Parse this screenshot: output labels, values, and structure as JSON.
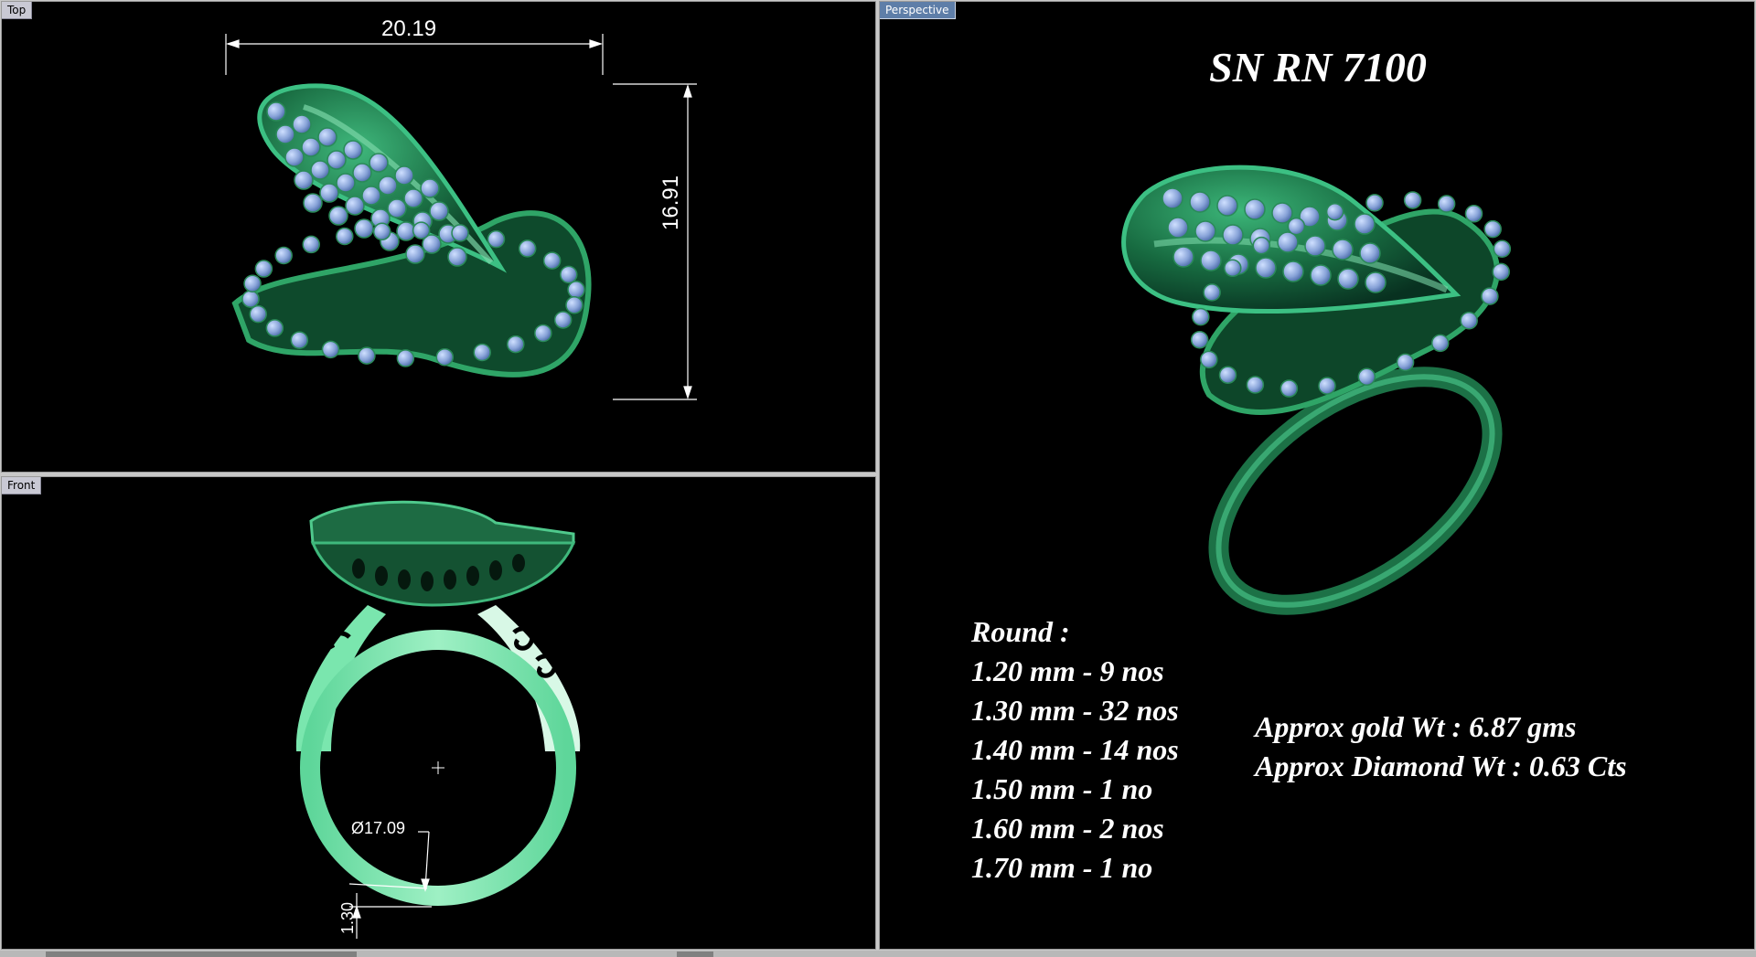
{
  "viewports": {
    "top": {
      "label": "Top"
    },
    "front": {
      "label": "Front"
    },
    "perspective": {
      "label": "Perspective"
    }
  },
  "dimensions": {
    "width": "20.19",
    "height": "16.91",
    "ring_diameter": "Ø17.09",
    "band_thickness": "1.30"
  },
  "design": {
    "title": "SN RN 7100",
    "round_heading": "Round :",
    "stones": [
      "1.20 mm - 9 nos",
      "1.30 mm - 32 nos",
      "1.40 mm - 14 nos",
      "1.50 mm - 1 no",
      "1.60 mm - 2 nos",
      "1.70 mm - 1 no"
    ],
    "gold_weight": "Approx gold Wt : 6.87 gms",
    "diamond_weight": "Approx Diamond  Wt : 0.63 Cts"
  },
  "colors": {
    "metal": "#1f7a4a",
    "metal_light": "#8fe0b4",
    "stone": "#8aa6d8",
    "background": "#000000"
  }
}
